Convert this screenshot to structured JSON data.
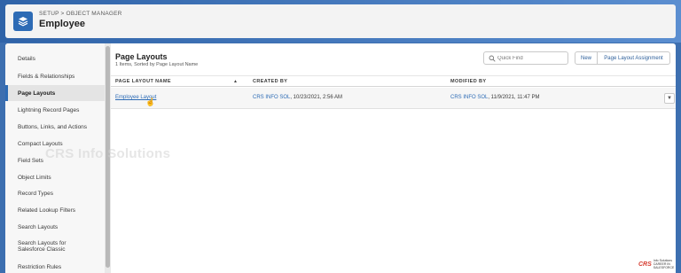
{
  "header": {
    "breadcrumb": "SETUP > OBJECT MANAGER",
    "title": "Employee"
  },
  "sidebar": {
    "items": [
      {
        "label": "Details",
        "active": false
      },
      {
        "label": "Fields & Relationships",
        "active": false
      },
      {
        "label": "Page Layouts",
        "active": true
      },
      {
        "label": "Lightning Record Pages",
        "active": false
      },
      {
        "label": "Buttons, Links, and Actions",
        "active": false
      },
      {
        "label": "Compact Layouts",
        "active": false
      },
      {
        "label": "Field Sets",
        "active": false
      },
      {
        "label": "Object Limits",
        "active": false
      },
      {
        "label": "Record Types",
        "active": false
      },
      {
        "label": "Related Lookup Filters",
        "active": false
      },
      {
        "label": "Search Layouts",
        "active": false
      },
      {
        "label": "Search Layouts for",
        "label2": "Salesforce Classic",
        "active": false
      },
      {
        "label": "Restriction Rules",
        "active": false
      }
    ]
  },
  "main": {
    "title": "Page Layouts",
    "subtitle": "1 Items, Sorted by Page Layout Name",
    "quick_find_placeholder": "Quick Find",
    "new_label": "New",
    "page_layout_assignment_label": "Page Layout Assignment",
    "columns": [
      "PAGE LAYOUT NAME",
      "CREATED BY",
      "MODIFIED BY"
    ],
    "rows": [
      {
        "name": "Employee Layout",
        "created_by_user": "CRS INFO SOL",
        "created_by_date": ", 10/23/2021, 2:56 AM",
        "modified_by_user": "CRS INFO SOL",
        "modified_by_date": ", 11/9/2021, 11:47 PM"
      }
    ]
  },
  "watermark": "CRS Info Solutions",
  "brand": {
    "main": "CRS",
    "sub_line1": "Info Solutions",
    "sub_line2": "CAREER IN SALESFORCE"
  },
  "colors": {
    "accent": "#2d6bb5",
    "brand_red": "#d63b2f",
    "page_bg": "#3d6fb0"
  },
  "icons": {
    "object": "layers-icon",
    "search": "search-icon",
    "sort": "sort-up-icon",
    "row_menu": "chevron-down-icon",
    "cursor": "hand-pointer-icon"
  }
}
